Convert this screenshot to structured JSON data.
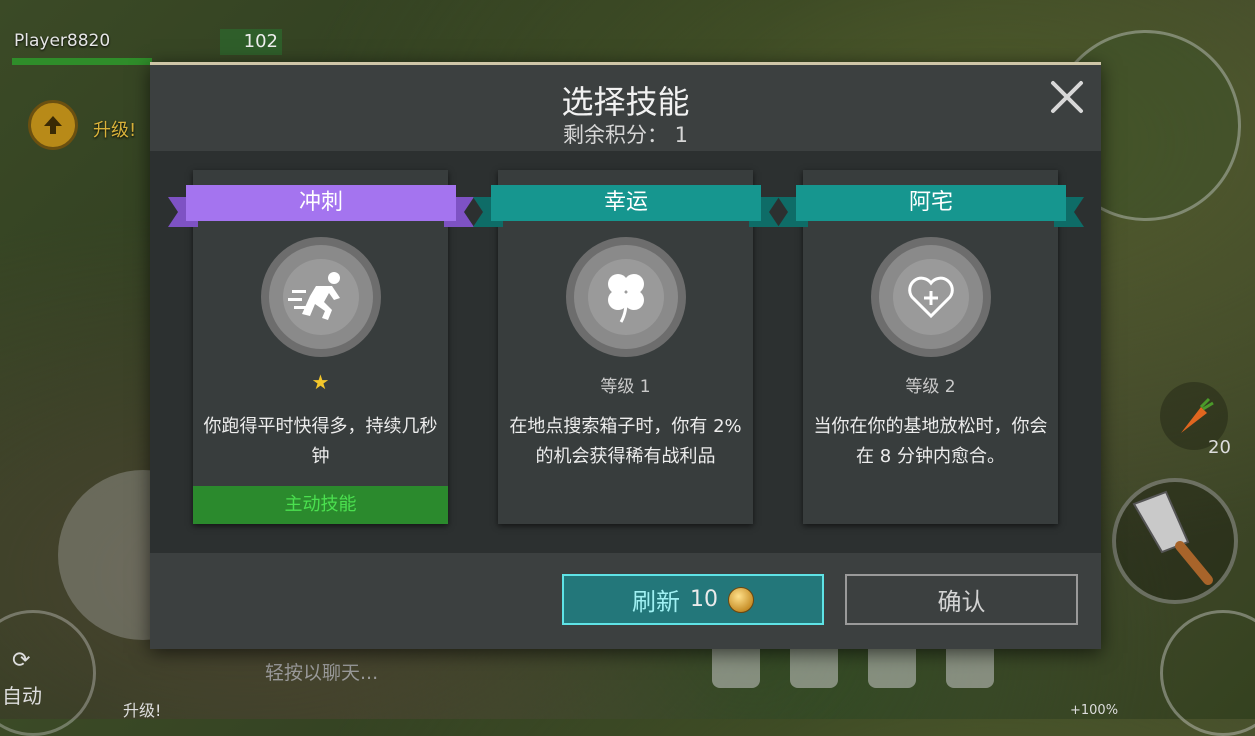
{
  "hud": {
    "player_name": "Player8820",
    "player_level": "102",
    "upgrade_label": "升级!",
    "carrot_count": "20",
    "auto_label": "自动",
    "chat_placeholder": "轻按以聊天...",
    "bottom_upgrade": "升级!",
    "percent": "+100%"
  },
  "dialog": {
    "title": "选择技能",
    "subtitle": "剩余积分： 1",
    "skills": [
      {
        "name": "冲刺",
        "ribbon_color": "#a474ef",
        "icon": "sprint-icon",
        "star": "★",
        "level": "",
        "description": "你跑得平时快得多，持续几秒钟",
        "tag": "主动技能"
      },
      {
        "name": "幸运",
        "ribbon_color": "#16968f",
        "icon": "clover-icon",
        "level": "等级 1",
        "description": "在地点搜索箱子时，你有 2% 的机会获得稀有战利品"
      },
      {
        "name": "阿宅",
        "ribbon_color": "#16968f",
        "icon": "heart-plus-icon",
        "level": "等级 2",
        "description": "当你在你的基地放松时，你会在 8 分钟内愈合。"
      }
    ],
    "refresh_label": "刷新",
    "refresh_cost": "10",
    "confirm_label": "确认"
  },
  "colors": {
    "accent": "#23777a",
    "active_tag": "#2b8a2d",
    "active_text": "#4be04f"
  }
}
